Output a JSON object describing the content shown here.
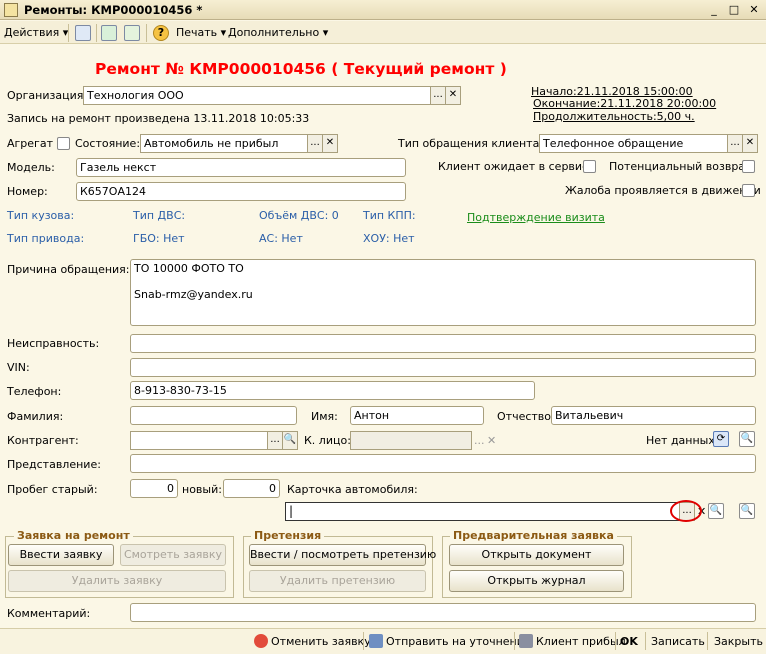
{
  "window": {
    "title": "Ремонты: КМР000010456 *",
    "min": "_",
    "max": "□",
    "close": "✕"
  },
  "toolbar": {
    "actions": "Действия ▾",
    "print": "Печать ▾",
    "more": "Дополнительно ▾",
    "help": "?"
  },
  "header": {
    "title": "Ремонт № КМР000010456 ( Текущий ремонт )",
    "record_made": "Запись на ремонт произведена 13.11.2018 10:05:33"
  },
  "org": {
    "label": "Организация:",
    "value": "Технология ООО"
  },
  "times": {
    "start": "Начало:21.11.2018 15:00:00",
    "end": "Окончание:21.11.2018 20:00:00",
    "duration": "Продолжительность:5,00 ч."
  },
  "aggregate": {
    "label": "Агрегат",
    "state_label": "Состояние:",
    "state_value": "Автомобиль не прибыл",
    "appeal_label": "Тип обращения клиента:",
    "appeal_value": "Телефонное обращение"
  },
  "model": {
    "label": "Модель:",
    "value": "Газель некст"
  },
  "number": {
    "label": "Номер:",
    "value": "К657ОА124"
  },
  "checks": {
    "waiting": "Клиент ожидает в сервисе",
    "potential": "Потенциальный возврат",
    "complaint": "Жалоба проявляется в движении"
  },
  "specs": {
    "body": "Тип кузова:",
    "engine": "Тип ДВС:",
    "volume": "Объём ДВС: 0",
    "gearbox": "Тип КПП:",
    "drive": "Тип привода:",
    "gbo": "ГБО: Нет",
    "ac": "АС: Нет",
    "hou": "ХОУ: Нет",
    "confirm": "Подтверждение визита"
  },
  "reason": {
    "label": "Причина обращения:",
    "line1": "ТО 10000 ФОТО ТО",
    "line2": "Snab-rmz@yandex.ru"
  },
  "fault": {
    "label": "Неисправность:",
    "value": ""
  },
  "vin": {
    "label": "VIN:",
    "value": ""
  },
  "phone": {
    "label": "Телефон:",
    "value": "8-913-830-73-15"
  },
  "names": {
    "last_label": "Фамилия:",
    "last_value": "",
    "first_label": "Имя:",
    "first_value": "Антон",
    "middle_label": "Отчество:",
    "middle_value": "Витальевич"
  },
  "contractor": {
    "label": "Контрагент:",
    "value": "",
    "person_label": "К. лицо:",
    "person_value": "",
    "no_data": "Нет данных."
  },
  "representation": {
    "label": "Представление:",
    "value": ""
  },
  "mileage": {
    "old_label": "Пробег старый:",
    "old_value": "0",
    "new_label": "новый:",
    "new_value": "0",
    "card_label": "Карточка автомобиля:",
    "card_value": ""
  },
  "groups": {
    "request": {
      "title": "Заявка на ремонт",
      "enter": "Ввести заявку",
      "view": "Смотреть заявку",
      "delete": "Удалить заявку"
    },
    "claim": {
      "title": "Претензия",
      "enter": "Ввести / посмотреть претензию",
      "delete": "Удалить претензию"
    },
    "pre": {
      "title": "Предварительная заявка",
      "open_doc": "Открыть документ",
      "open_journal": "Открыть журнал"
    }
  },
  "comment": {
    "label": "Комментарий:",
    "value": ""
  },
  "footer": {
    "cancel": "Отменить заявку",
    "send": "Отправить на уточнение",
    "arrived": "Клиент прибыл",
    "ok": "OK",
    "save": "Записать",
    "close": "Закрыть"
  }
}
